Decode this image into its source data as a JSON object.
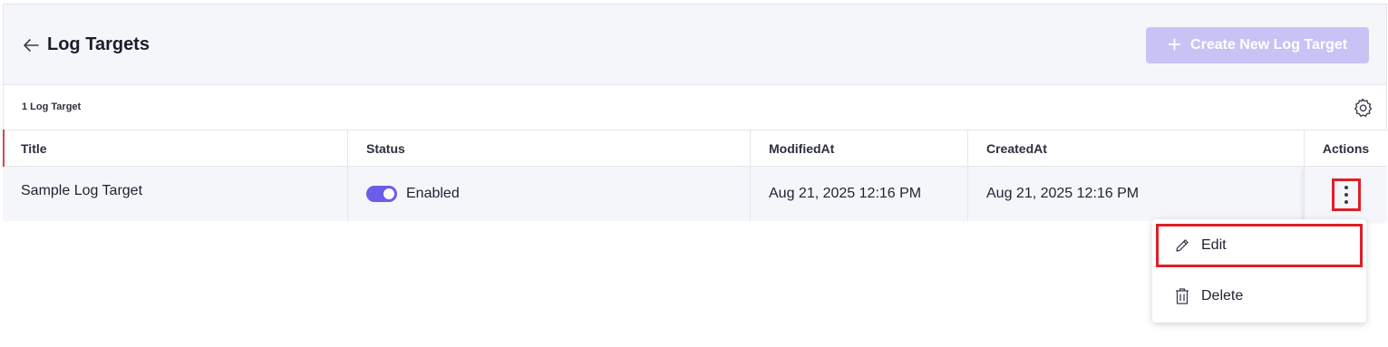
{
  "header": {
    "title": "Log Targets",
    "create_button_label": "Create New Log Target"
  },
  "toolbar": {
    "count_label": "1 Log Target"
  },
  "table": {
    "columns": [
      "Title",
      "Status",
      "ModifiedAt",
      "CreatedAt",
      "Actions"
    ],
    "rows": [
      {
        "title": "Sample Log Target",
        "status": "Enabled",
        "status_enabled": true,
        "modified_at": "Aug 21, 2025 12:16 PM",
        "created_at": "Aug 21, 2025 12:16 PM"
      }
    ]
  },
  "action_menu": {
    "items": [
      "Edit",
      "Delete"
    ]
  },
  "colors": {
    "accent": "#6c5ce7",
    "create_button_bg": "#c7c3f5",
    "highlight": "#e01e26",
    "header_bg": "#f5f6fa"
  },
  "icons": {
    "back": "arrow-left-icon",
    "create": "plus-icon",
    "settings": "gear-icon",
    "row_actions": "more-vertical-icon",
    "edit": "pencil-icon",
    "delete": "trash-icon"
  }
}
